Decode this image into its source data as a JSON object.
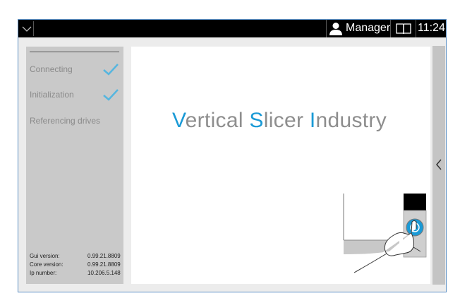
{
  "topbar": {
    "menu_icon": "chevron-down-icon",
    "user_icon": "user-icon",
    "user_label": "Manager",
    "book_icon": "book-icon",
    "time": "11:24"
  },
  "sidebar": {
    "steps": [
      {
        "label": "Connecting",
        "done": true
      },
      {
        "label": "Initialization",
        "done": true
      },
      {
        "label": "Referencing drives",
        "done": false
      }
    ],
    "versions": [
      {
        "label": "Gui version:",
        "value": "0.99.21.8809"
      },
      {
        "label": "Core version:",
        "value": "0.99.21.8809"
      },
      {
        "label": "Ip number:",
        "value": "10.206.5.148"
      }
    ]
  },
  "main": {
    "title_parts": [
      {
        "text": "V",
        "accent": true
      },
      {
        "text": "ertical ",
        "accent": false
      },
      {
        "text": "S",
        "accent": true
      },
      {
        "text": "licer ",
        "accent": false
      },
      {
        "text": "I",
        "accent": true
      },
      {
        "text": "ndustry",
        "accent": false
      }
    ]
  },
  "colors": {
    "accent": "#1a9ad6",
    "check": "#56b6df",
    "topbar": "#000000"
  },
  "right_handle_icon": "chevron-left-icon"
}
